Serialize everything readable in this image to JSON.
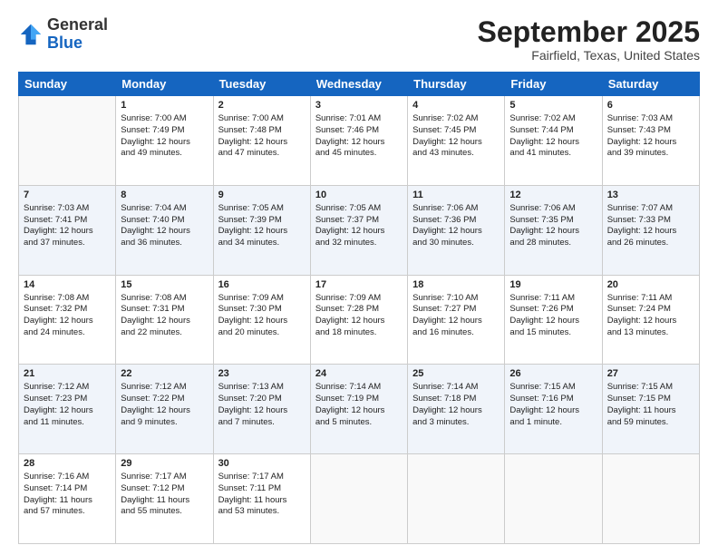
{
  "header": {
    "logo_general": "General",
    "logo_blue": "Blue",
    "month_title": "September 2025",
    "location": "Fairfield, Texas, United States"
  },
  "weekdays": [
    "Sunday",
    "Monday",
    "Tuesday",
    "Wednesday",
    "Thursday",
    "Friday",
    "Saturday"
  ],
  "weeks": [
    [
      {
        "day": "",
        "info": ""
      },
      {
        "day": "1",
        "info": "Sunrise: 7:00 AM\nSunset: 7:49 PM\nDaylight: 12 hours\nand 49 minutes."
      },
      {
        "day": "2",
        "info": "Sunrise: 7:00 AM\nSunset: 7:48 PM\nDaylight: 12 hours\nand 47 minutes."
      },
      {
        "day": "3",
        "info": "Sunrise: 7:01 AM\nSunset: 7:46 PM\nDaylight: 12 hours\nand 45 minutes."
      },
      {
        "day": "4",
        "info": "Sunrise: 7:02 AM\nSunset: 7:45 PM\nDaylight: 12 hours\nand 43 minutes."
      },
      {
        "day": "5",
        "info": "Sunrise: 7:02 AM\nSunset: 7:44 PM\nDaylight: 12 hours\nand 41 minutes."
      },
      {
        "day": "6",
        "info": "Sunrise: 7:03 AM\nSunset: 7:43 PM\nDaylight: 12 hours\nand 39 minutes."
      }
    ],
    [
      {
        "day": "7",
        "info": "Sunrise: 7:03 AM\nSunset: 7:41 PM\nDaylight: 12 hours\nand 37 minutes."
      },
      {
        "day": "8",
        "info": "Sunrise: 7:04 AM\nSunset: 7:40 PM\nDaylight: 12 hours\nand 36 minutes."
      },
      {
        "day": "9",
        "info": "Sunrise: 7:05 AM\nSunset: 7:39 PM\nDaylight: 12 hours\nand 34 minutes."
      },
      {
        "day": "10",
        "info": "Sunrise: 7:05 AM\nSunset: 7:37 PM\nDaylight: 12 hours\nand 32 minutes."
      },
      {
        "day": "11",
        "info": "Sunrise: 7:06 AM\nSunset: 7:36 PM\nDaylight: 12 hours\nand 30 minutes."
      },
      {
        "day": "12",
        "info": "Sunrise: 7:06 AM\nSunset: 7:35 PM\nDaylight: 12 hours\nand 28 minutes."
      },
      {
        "day": "13",
        "info": "Sunrise: 7:07 AM\nSunset: 7:33 PM\nDaylight: 12 hours\nand 26 minutes."
      }
    ],
    [
      {
        "day": "14",
        "info": "Sunrise: 7:08 AM\nSunset: 7:32 PM\nDaylight: 12 hours\nand 24 minutes."
      },
      {
        "day": "15",
        "info": "Sunrise: 7:08 AM\nSunset: 7:31 PM\nDaylight: 12 hours\nand 22 minutes."
      },
      {
        "day": "16",
        "info": "Sunrise: 7:09 AM\nSunset: 7:30 PM\nDaylight: 12 hours\nand 20 minutes."
      },
      {
        "day": "17",
        "info": "Sunrise: 7:09 AM\nSunset: 7:28 PM\nDaylight: 12 hours\nand 18 minutes."
      },
      {
        "day": "18",
        "info": "Sunrise: 7:10 AM\nSunset: 7:27 PM\nDaylight: 12 hours\nand 16 minutes."
      },
      {
        "day": "19",
        "info": "Sunrise: 7:11 AM\nSunset: 7:26 PM\nDaylight: 12 hours\nand 15 minutes."
      },
      {
        "day": "20",
        "info": "Sunrise: 7:11 AM\nSunset: 7:24 PM\nDaylight: 12 hours\nand 13 minutes."
      }
    ],
    [
      {
        "day": "21",
        "info": "Sunrise: 7:12 AM\nSunset: 7:23 PM\nDaylight: 12 hours\nand 11 minutes."
      },
      {
        "day": "22",
        "info": "Sunrise: 7:12 AM\nSunset: 7:22 PM\nDaylight: 12 hours\nand 9 minutes."
      },
      {
        "day": "23",
        "info": "Sunrise: 7:13 AM\nSunset: 7:20 PM\nDaylight: 12 hours\nand 7 minutes."
      },
      {
        "day": "24",
        "info": "Sunrise: 7:14 AM\nSunset: 7:19 PM\nDaylight: 12 hours\nand 5 minutes."
      },
      {
        "day": "25",
        "info": "Sunrise: 7:14 AM\nSunset: 7:18 PM\nDaylight: 12 hours\nand 3 minutes."
      },
      {
        "day": "26",
        "info": "Sunrise: 7:15 AM\nSunset: 7:16 PM\nDaylight: 12 hours\nand 1 minute."
      },
      {
        "day": "27",
        "info": "Sunrise: 7:15 AM\nSunset: 7:15 PM\nDaylight: 11 hours\nand 59 minutes."
      }
    ],
    [
      {
        "day": "28",
        "info": "Sunrise: 7:16 AM\nSunset: 7:14 PM\nDaylight: 11 hours\nand 57 minutes."
      },
      {
        "day": "29",
        "info": "Sunrise: 7:17 AM\nSunset: 7:12 PM\nDaylight: 11 hours\nand 55 minutes."
      },
      {
        "day": "30",
        "info": "Sunrise: 7:17 AM\nSunset: 7:11 PM\nDaylight: 11 hours\nand 53 minutes."
      },
      {
        "day": "",
        "info": ""
      },
      {
        "day": "",
        "info": ""
      },
      {
        "day": "",
        "info": ""
      },
      {
        "day": "",
        "info": ""
      }
    ]
  ]
}
